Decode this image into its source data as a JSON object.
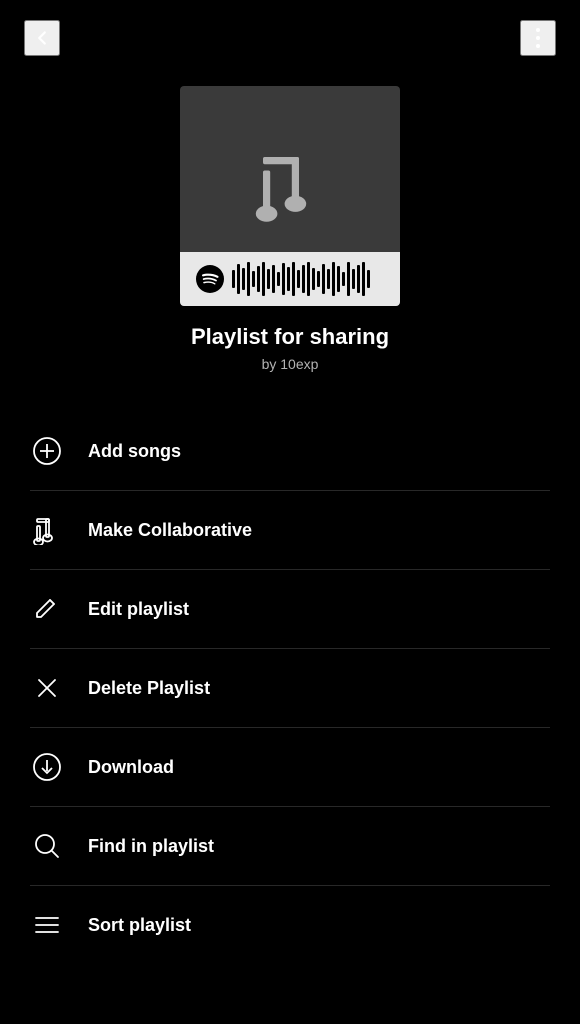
{
  "header": {
    "back_label": "Back",
    "more_label": "More options"
  },
  "playlist": {
    "title": "Playlist for sharing",
    "author": "by 10exp"
  },
  "menu_items": [
    {
      "id": "add-songs",
      "label": "Add songs",
      "icon": "plus-circle-icon"
    },
    {
      "id": "make-collaborative",
      "label": "Make Collaborative",
      "icon": "music-note-icon"
    },
    {
      "id": "edit-playlist",
      "label": "Edit playlist",
      "icon": "pencil-icon"
    },
    {
      "id": "delete-playlist",
      "label": "Delete Playlist",
      "icon": "x-icon"
    },
    {
      "id": "download",
      "label": "Download",
      "icon": "download-circle-icon"
    },
    {
      "id": "find-in-playlist",
      "label": "Find in playlist",
      "icon": "search-icon"
    },
    {
      "id": "sort-playlist",
      "label": "Sort playlist",
      "icon": "sort-icon"
    }
  ],
  "colors": {
    "background": "#000000",
    "text_primary": "#ffffff",
    "text_secondary": "#b3b3b3",
    "cover_bg": "#3a3a3a",
    "divider": "#282828"
  }
}
